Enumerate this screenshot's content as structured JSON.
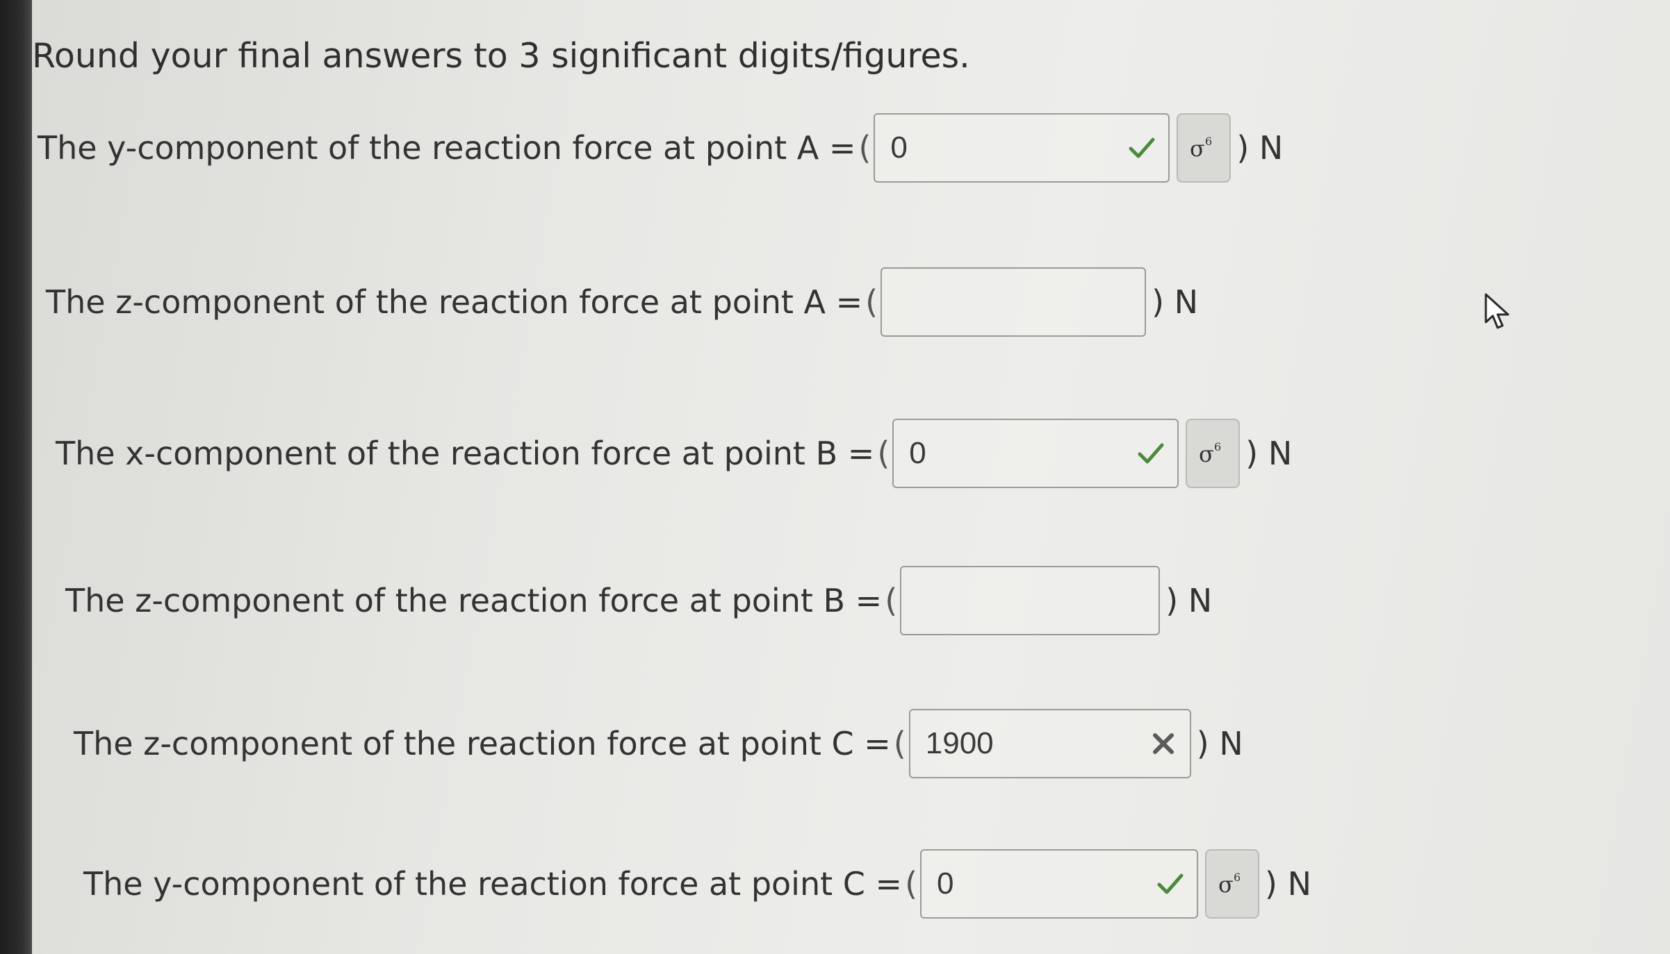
{
  "instruction": "Round your final answers to 3 significant digits/figures.",
  "paren_open": "(",
  "unit": ") N",
  "hint_icon": "sigma-hint-icon",
  "colors": {
    "correct": "#4a8a3a",
    "incorrect": "#5a5a5a",
    "box_border": "#9a9a96"
  },
  "questions": [
    {
      "label": "The y-component of the reaction force at point A =",
      "value": "0",
      "status": "correct",
      "has_hint": true
    },
    {
      "label": "The z-component of the reaction force at point A =",
      "value": "",
      "status": "none",
      "has_hint": false
    },
    {
      "label": "The x-component of the reaction force at point B =",
      "value": "0",
      "status": "correct",
      "has_hint": true
    },
    {
      "label": "The z-component of the reaction force at point B =",
      "value": "",
      "status": "none",
      "has_hint": false
    },
    {
      "label": "The z-component of the reaction force at point C =",
      "value": "1900",
      "status": "incorrect",
      "has_hint": false
    },
    {
      "label": "The y-component of the reaction force at point C =",
      "value": "0",
      "status": "correct",
      "has_hint": true
    }
  ]
}
